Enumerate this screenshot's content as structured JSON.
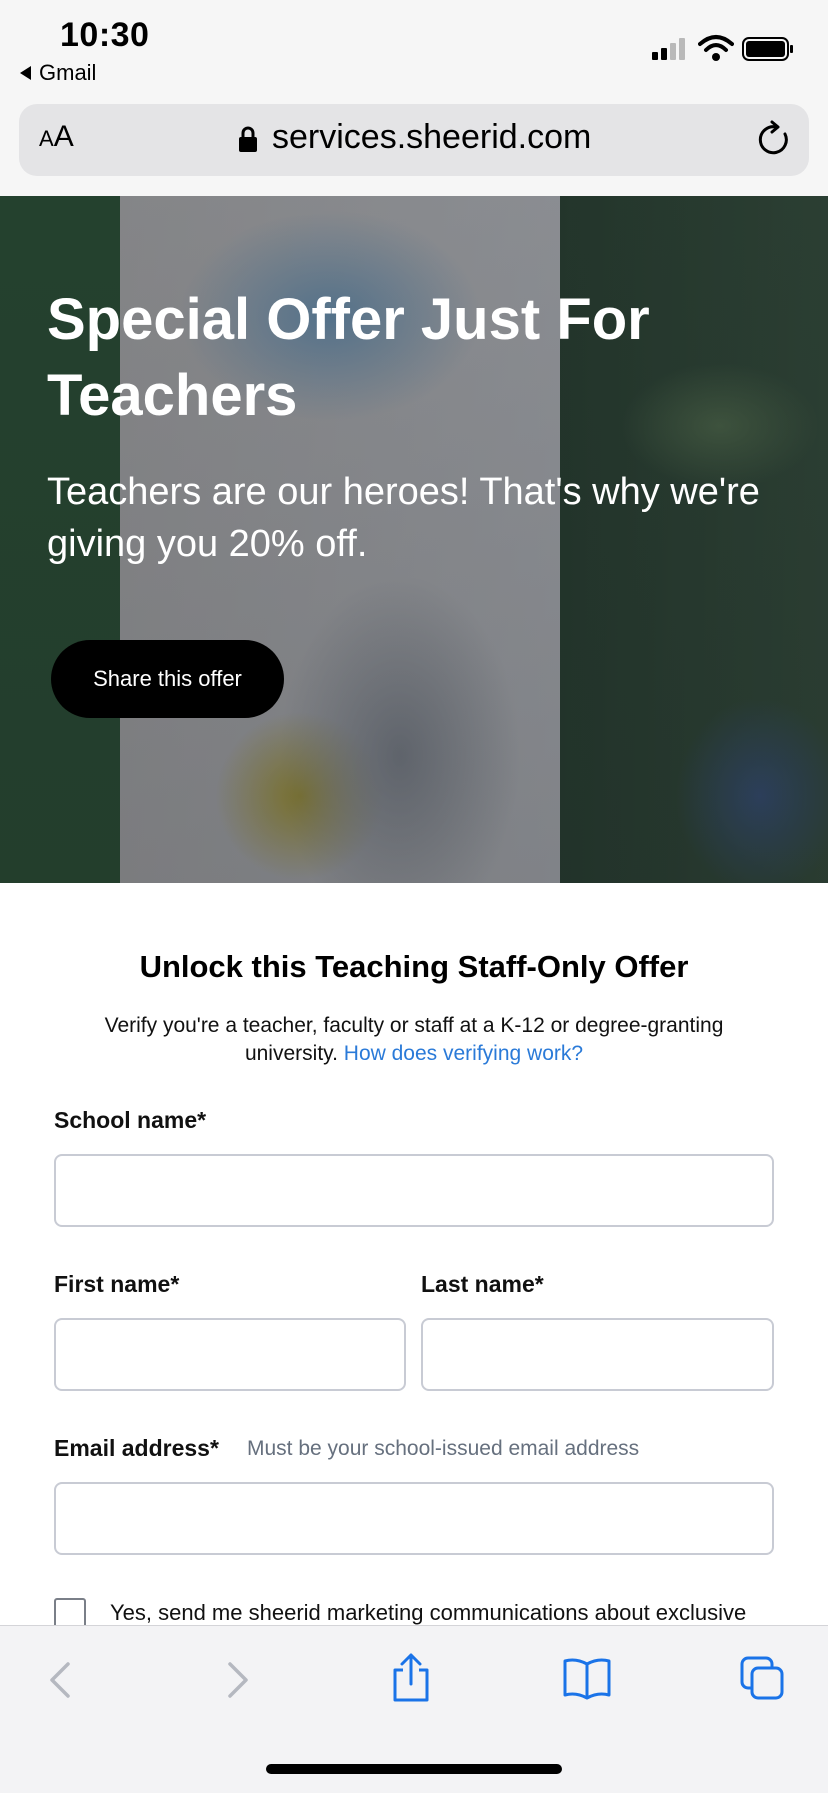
{
  "status_bar": {
    "time": "10:30",
    "back_app": "Gmail"
  },
  "url_bar": {
    "text_size_label_small": "A",
    "text_size_label_large": "A",
    "url": "services.sheerid.com"
  },
  "hero": {
    "title": "Special Offer Just For Teachers",
    "subtitle": "Teachers are our heroes! That's why we're giving you 20% off.",
    "share_button": "Share this offer"
  },
  "form": {
    "title": "Unlock this Teaching Staff-Only Offer",
    "description": "Verify you're a teacher, faculty or staff at a K-12 or degree-granting university.",
    "help_link": "How does verifying work?",
    "school_label": "School name*",
    "school_value": "",
    "first_name_label": "First name*",
    "first_name_value": "",
    "last_name_label": "Last name*",
    "last_name_value": "",
    "email_label": "Email address*",
    "email_hint": "Must be your school-issued email address",
    "email_value": "",
    "consent_text": "Yes, send me sheerid marketing communications about exclusive",
    "consent_checked": false
  },
  "colors": {
    "link": "#2a7ad8",
    "icon_blue": "#1a73e8"
  }
}
